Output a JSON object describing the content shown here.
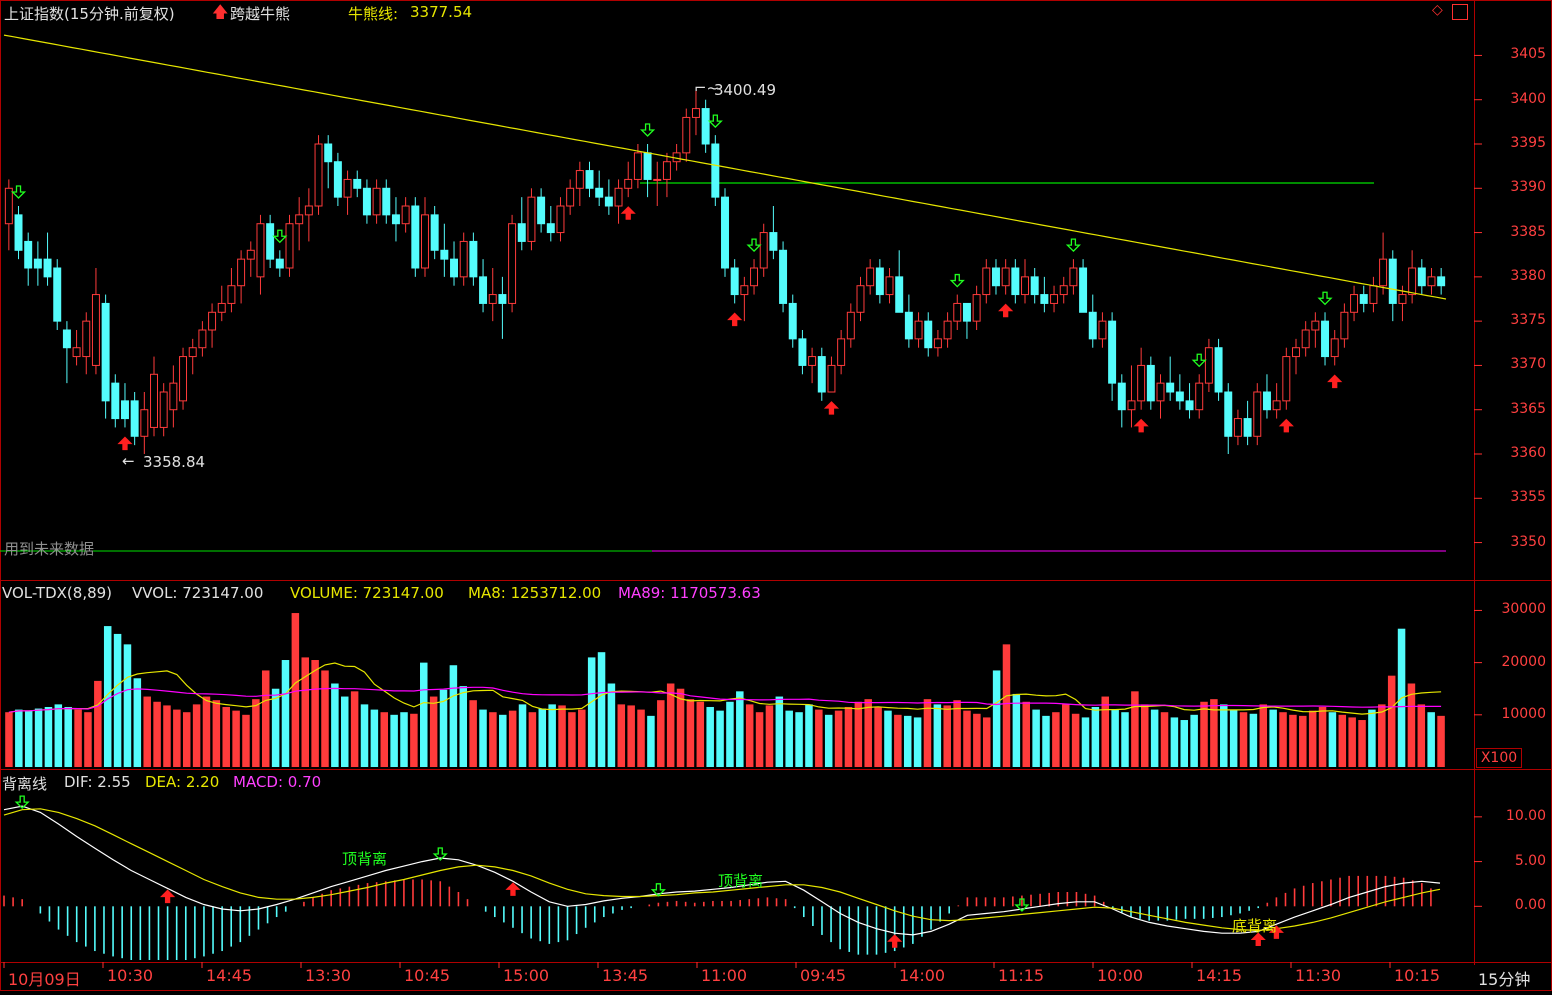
{
  "header": {
    "title": "上证指数(15分钟.前复权)",
    "indicator": "跨越牛熊",
    "line_label": "牛熊线:",
    "line_value": "3377.54"
  },
  "future_note": "用到未来数据",
  "vol_header": {
    "name": "VOL-TDX(8,89)",
    "vvol": "VVOL: 723147.00",
    "volume": "VOLUME: 723147.00",
    "ma8": "MA8: 1253712.00",
    "ma89": "MA89: 1170573.63"
  },
  "macd_header": {
    "name": "背离线",
    "dif": "DIF: 2.55",
    "dea": "DEA: 2.20",
    "macd": "MACD: 0.70"
  },
  "x100": "X100",
  "period_label": "15分钟",
  "colors": {
    "up": "#ff3b3b",
    "down": "#54fcfc",
    "bull_bear": "#e6e600",
    "ma89": "#ff00ff",
    "grid": "#b00000",
    "green": "#00e000"
  },
  "chart_data": [
    {
      "type": "candlestick",
      "ylim": [
        3346,
        3409
      ],
      "yticks": [
        "3405",
        "3400",
        "3395",
        "3390",
        "3385",
        "3380",
        "3375",
        "3370",
        "3365",
        "3360",
        "3355",
        "3350"
      ],
      "annotations": [
        {
          "text": "3400.49"
        },
        {
          "text": "3358.84"
        }
      ],
      "horizontal_line": 3390.6,
      "bull_bear_line": {
        "start": 3407.3,
        "end": 3377.5
      },
      "ohlc": [
        [
          3386,
          3391,
          3383,
          3390
        ],
        [
          3387,
          3388,
          3382,
          3383
        ],
        [
          3384,
          3385,
          3379,
          3381
        ],
        [
          3382,
          3384,
          3379,
          3381
        ],
        [
          3382,
          3385,
          3379,
          3380
        ],
        [
          3381,
          3382,
          3374,
          3375
        ],
        [
          3374,
          3375,
          3368,
          3372
        ],
        [
          3371,
          3374,
          3370,
          3372
        ],
        [
          3371,
          3376,
          3369,
          3375
        ],
        [
          3370,
          3381,
          3369,
          3378
        ],
        [
          3377,
          3378,
          3364,
          3366
        ],
        [
          3368,
          3369,
          3363,
          3364
        ],
        [
          3366,
          3368,
          3363,
          3364
        ],
        [
          3366,
          3367,
          3361,
          3362
        ],
        [
          3362,
          3367,
          3360,
          3365
        ],
        [
          3363,
          3371,
          3362,
          3369
        ],
        [
          3363,
          3368,
          3362,
          3367
        ],
        [
          3365,
          3370,
          3363,
          3368
        ],
        [
          3366,
          3372,
          3365,
          3371
        ],
        [
          3371,
          3373,
          3369,
          3372
        ],
        [
          3372,
          3375,
          3371,
          3374
        ],
        [
          3374,
          3377,
          3372,
          3376
        ],
        [
          3376,
          3379,
          3375,
          3377
        ],
        [
          3377,
          3381,
          3376,
          3379
        ],
        [
          3379,
          3383,
          3377,
          3382
        ],
        [
          3382,
          3384,
          3380,
          3383
        ],
        [
          3380,
          3387,
          3378,
          3386
        ],
        [
          3386,
          3387,
          3381,
          3382
        ],
        [
          3382,
          3383,
          3380,
          3381
        ],
        [
          3381,
          3387,
          3380,
          3386
        ],
        [
          3386,
          3389,
          3383,
          3387
        ],
        [
          3387,
          3390,
          3384,
          3388
        ],
        [
          3388,
          3396,
          3387,
          3395
        ],
        [
          3395,
          3396,
          3390,
          3393
        ],
        [
          3393,
          3394,
          3388,
          3389
        ],
        [
          3389,
          3392,
          3387,
          3391
        ],
        [
          3391,
          3392,
          3389,
          3390
        ],
        [
          3390,
          3391,
          3386,
          3387
        ],
        [
          3387,
          3391,
          3386,
          3390
        ],
        [
          3390,
          3391,
          3386,
          3387
        ],
        [
          3387,
          3389,
          3384,
          3386
        ],
        [
          3386,
          3389,
          3385,
          3388
        ],
        [
          3388,
          3389,
          3380,
          3381
        ],
        [
          3381,
          3389,
          3380,
          3387
        ],
        [
          3387,
          3388,
          3382,
          3383
        ],
        [
          3383,
          3386,
          3380,
          3382
        ],
        [
          3382,
          3384,
          3379,
          3380
        ],
        [
          3380,
          3385,
          3379,
          3384
        ],
        [
          3384,
          3385,
          3379,
          3380
        ],
        [
          3380,
          3382,
          3376,
          3377
        ],
        [
          3377,
          3381,
          3375,
          3378
        ],
        [
          3378,
          3380,
          3373,
          3377
        ],
        [
          3377,
          3387,
          3376,
          3386
        ],
        [
          3386,
          3389,
          3383,
          3384
        ],
        [
          3384,
          3390,
          3383,
          3389
        ],
        [
          3389,
          3390,
          3385,
          3386
        ],
        [
          3386,
          3388,
          3384,
          3385
        ],
        [
          3385,
          3389,
          3384,
          3388
        ],
        [
          3388,
          3391,
          3387,
          3390
        ],
        [
          3390,
          3393,
          3388,
          3392
        ],
        [
          3392,
          3393,
          3389,
          3390
        ],
        [
          3390,
          3392,
          3388,
          3389
        ],
        [
          3389,
          3391,
          3387,
          3388
        ],
        [
          3388,
          3391,
          3386,
          3390
        ],
        [
          3390,
          3393,
          3389,
          3391
        ],
        [
          3391,
          3395,
          3390,
          3394
        ],
        [
          3394,
          3395,
          3389,
          3391
        ],
        [
          3391,
          3393,
          3388,
          3391
        ],
        [
          3391,
          3394,
          3389,
          3393
        ],
        [
          3393,
          3395,
          3392,
          3394
        ],
        [
          3394,
          3399,
          3393,
          3398
        ],
        [
          3398,
          3401,
          3396,
          3399
        ],
        [
          3399,
          3400,
          3394,
          3395
        ],
        [
          3395,
          3396,
          3388,
          3389
        ],
        [
          3389,
          3390,
          3380,
          3381
        ],
        [
          3381,
          3382,
          3377,
          3378
        ],
        [
          3378,
          3380,
          3375,
          3379
        ],
        [
          3379,
          3382,
          3378,
          3381
        ],
        [
          3381,
          3386,
          3380,
          3385
        ],
        [
          3385,
          3388,
          3382,
          3383
        ],
        [
          3383,
          3384,
          3376,
          3377
        ],
        [
          3377,
          3378,
          3372,
          3373
        ],
        [
          3373,
          3374,
          3369,
          3370
        ],
        [
          3370,
          3372,
          3368,
          3371
        ],
        [
          3371,
          3372,
          3366,
          3367
        ],
        [
          3367,
          3371,
          3367,
          3370
        ],
        [
          3370,
          3374,
          3369,
          3373
        ],
        [
          3373,
          3377,
          3372,
          3376
        ],
        [
          3376,
          3380,
          3375,
          3379
        ],
        [
          3379,
          3382,
          3378,
          3381
        ],
        [
          3381,
          3382,
          3377,
          3378
        ],
        [
          3378,
          3381,
          3377,
          3380
        ],
        [
          3380,
          3383,
          3378,
          3376
        ],
        [
          3376,
          3378,
          3372,
          3373
        ],
        [
          3373,
          3376,
          3372,
          3375
        ],
        [
          3375,
          3376,
          3371,
          3372
        ],
        [
          3372,
          3374,
          3371,
          3373
        ],
        [
          3373,
          3376,
          3372,
          3375
        ],
        [
          3375,
          3378,
          3374,
          3377
        ],
        [
          3377,
          3377,
          3373,
          3375
        ],
        [
          3375,
          3379,
          3374,
          3378
        ],
        [
          3378,
          3382,
          3377,
          3381
        ],
        [
          3381,
          3382,
          3378,
          3379
        ],
        [
          3379,
          3382,
          3378,
          3381
        ],
        [
          3381,
          3382,
          3377,
          3378
        ],
        [
          3378,
          3382,
          3377,
          3380
        ],
        [
          3380,
          3381,
          3377,
          3378
        ],
        [
          3378,
          3380,
          3376,
          3377
        ],
        [
          3377,
          3379,
          3376,
          3378
        ],
        [
          3378,
          3380,
          3377,
          3379
        ],
        [
          3379,
          3382,
          3378,
          3381
        ],
        [
          3381,
          3382,
          3377,
          3376
        ],
        [
          3376,
          3378,
          3372,
          3373
        ],
        [
          3373,
          3376,
          3372,
          3375
        ],
        [
          3375,
          3376,
          3366,
          3368
        ],
        [
          3368,
          3369,
          3363,
          3365
        ],
        [
          3365,
          3370,
          3363,
          3366
        ],
        [
          3366,
          3372,
          3365,
          3370
        ],
        [
          3370,
          3371,
          3365,
          3366
        ],
        [
          3366,
          3369,
          3364,
          3368
        ],
        [
          3368,
          3371,
          3366,
          3367
        ],
        [
          3367,
          3369,
          3365,
          3366
        ],
        [
          3366,
          3368,
          3364,
          3365
        ],
        [
          3365,
          3369,
          3364,
          3368
        ],
        [
          3368,
          3373,
          3367,
          3372
        ],
        [
          3372,
          3373,
          3366,
          3367
        ],
        [
          3367,
          3368,
          3360,
          3362
        ],
        [
          3362,
          3365,
          3361,
          3364
        ],
        [
          3364,
          3366,
          3361,
          3362
        ],
        [
          3362,
          3368,
          3361,
          3367
        ],
        [
          3367,
          3369,
          3364,
          3365
        ],
        [
          3365,
          3368,
          3364,
          3366
        ],
        [
          3366,
          3372,
          3365,
          3371
        ],
        [
          3371,
          3373,
          3369,
          3372
        ],
        [
          3372,
          3375,
          3371,
          3374
        ],
        [
          3374,
          3376,
          3372,
          3375
        ],
        [
          3375,
          3376,
          3370,
          3371
        ],
        [
          3371,
          3374,
          3370,
          3373
        ],
        [
          3373,
          3377,
          3372,
          3376
        ],
        [
          3376,
          3379,
          3375,
          3378
        ],
        [
          3378,
          3379,
          3376,
          3377
        ],
        [
          3377,
          3380,
          3376,
          3379
        ],
        [
          3379,
          3385,
          3378,
          3382
        ],
        [
          3382,
          3383,
          3375,
          3377
        ],
        [
          3377,
          3379,
          3375,
          3378
        ],
        [
          3378,
          3383,
          3377,
          3381
        ],
        [
          3381,
          3382,
          3378,
          3379
        ],
        [
          3379,
          3381,
          3378,
          3380
        ],
        [
          3380,
          3381,
          3378,
          3379
        ]
      ]
    },
    {
      "type": "bar",
      "title": "VOL-TDX(8,89)",
      "ylim": [
        0,
        32000
      ],
      "yticks": [
        "30000",
        "20000",
        "10000"
      ],
      "units": "X100",
      "values": [
        10500,
        11000,
        10800,
        11200,
        11500,
        12000,
        11500,
        11000,
        10500,
        16500,
        27000,
        25500,
        23500,
        17000,
        13500,
        12500,
        11800,
        11000,
        10500,
        12000,
        13500,
        12800,
        11500,
        10800,
        10000,
        13000,
        18500,
        15000,
        20500,
        29500,
        21000,
        20500,
        18500,
        16000,
        13500,
        14500,
        12000,
        11000,
        10500,
        10000,
        10500,
        10200,
        20000,
        13500,
        14800,
        19500,
        15500,
        12800,
        11000,
        10500,
        10000,
        10800,
        12000,
        10500,
        11200,
        12000,
        11800,
        10500,
        11000,
        21000,
        22000,
        16000,
        12000,
        11800,
        11000,
        9800,
        12800,
        16000,
        15000,
        13000,
        12500,
        11500,
        10800,
        12500,
        14500,
        12000,
        10500,
        11800,
        13500,
        10800,
        10500,
        12000,
        11000,
        10000,
        10800,
        11500,
        12500,
        13000,
        11500,
        10800,
        10000,
        9800,
        9500,
        13000,
        12000,
        11800,
        12800,
        10800,
        10200,
        9500,
        18500,
        23500,
        14000,
        12500,
        11000,
        9800,
        10500,
        12000,
        10200,
        9500,
        11500,
        13500,
        11000,
        10500,
        14500,
        12000,
        11000,
        10500,
        9500,
        9000,
        10000,
        12500,
        13000,
        12000,
        11000,
        10500,
        10200,
        12000,
        11000,
        10500,
        10000,
        9800,
        10800,
        11500,
        10500,
        10000,
        9500,
        9000,
        11000,
        12000,
        17500,
        26500,
        16000,
        12000,
        10500,
        9800
      ],
      "ma8_color": "#e6e600",
      "ma89_color": "#ff00ff"
    },
    {
      "type": "line",
      "title": "背离线",
      "ylim": [
        -6,
        13
      ],
      "yticks": [
        "10.00",
        "5.00",
        "0.00"
      ],
      "series": [
        {
          "name": "DIF",
          "color": "#ffffff",
          "values": [
            10.8,
            11.2,
            10.5,
            9.2,
            7.8,
            6.5,
            5.2,
            4.0,
            3.0,
            2.0,
            1.0,
            0.2,
            -0.3,
            -0.5,
            -0.3,
            0.2,
            0.8,
            1.5,
            2.2,
            2.8,
            3.4,
            4.0,
            4.5,
            5.0,
            5.4,
            5.2,
            4.6,
            3.8,
            2.8,
            1.6,
            0.5,
            0.0,
            0.2,
            0.6,
            0.9,
            1.1,
            1.4,
            1.6,
            1.7,
            1.9,
            2.1,
            2.4,
            2.7,
            2.8,
            1.8,
            0.5,
            -0.8,
            -1.8,
            -2.5,
            -3.0,
            -3.2,
            -2.8,
            -2.0,
            -1.0,
            -0.8,
            -0.6,
            -0.3,
            0.0,
            0.3,
            0.5,
            0.5,
            -0.3,
            -1.2,
            -1.8,
            -2.2,
            -2.5,
            -2.8,
            -3.0,
            -3.0,
            -2.8,
            -2.0,
            -1.2,
            -0.5,
            0.2,
            1.0,
            1.6,
            2.2,
            2.6,
            2.8,
            2.6
          ]
        },
        {
          "name": "DEA",
          "color": "#e6e600",
          "values": [
            10.2,
            10.8,
            10.9,
            10.5,
            9.8,
            9.0,
            8.0,
            7.0,
            6.0,
            5.0,
            4.0,
            3.0,
            2.2,
            1.5,
            1.0,
            0.8,
            0.8,
            1.0,
            1.3,
            1.7,
            2.1,
            2.6,
            3.0,
            3.5,
            4.0,
            4.4,
            4.6,
            4.4,
            4.0,
            3.4,
            2.6,
            1.9,
            1.4,
            1.2,
            1.1,
            1.1,
            1.2,
            1.3,
            1.5,
            1.6,
            1.8,
            2.0,
            2.2,
            2.4,
            2.4,
            2.1,
            1.6,
            0.9,
            0.2,
            -0.5,
            -1.1,
            -1.5,
            -1.6,
            -1.5,
            -1.3,
            -1.1,
            -0.9,
            -0.7,
            -0.5,
            -0.3,
            -0.1,
            -0.2,
            -0.6,
            -1.0,
            -1.4,
            -1.8,
            -2.1,
            -2.4,
            -2.6,
            -2.7,
            -2.5,
            -2.2,
            -1.8,
            -1.3,
            -0.7,
            -0.1,
            0.5,
            1.0,
            1.5,
            1.9
          ]
        }
      ],
      "signals": [
        "顶背离",
        "顶背离",
        "底背离"
      ]
    }
  ],
  "x_axis_labels": [
    "10月09日",
    "10:30",
    "14:45",
    "13:30",
    "10:45",
    "15:00",
    "13:45",
    "11:00",
    "09:45",
    "14:00",
    "11:15",
    "10:00",
    "14:15",
    "11:30",
    "10:15"
  ]
}
